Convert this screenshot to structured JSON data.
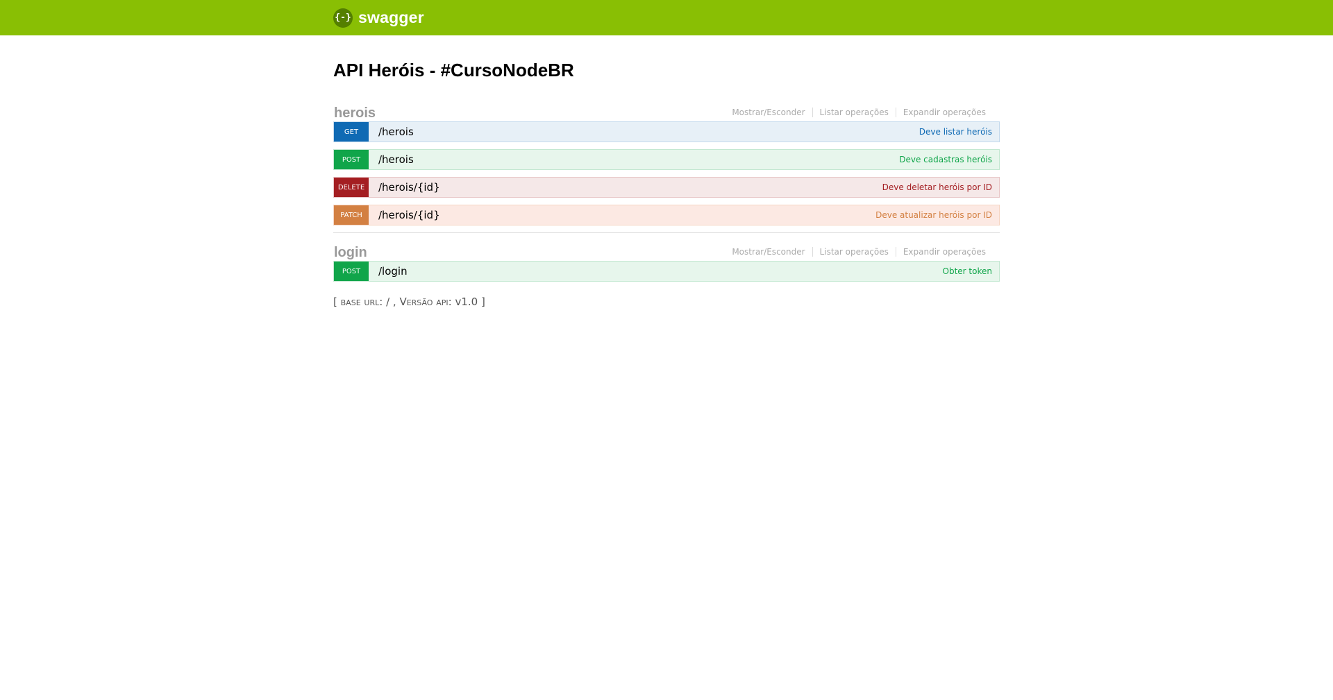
{
  "header": {
    "logo_icon": "{-}",
    "logo_text": "swagger"
  },
  "title": "API Heróis - #CursoNodeBR",
  "resources": [
    {
      "name": "herois",
      "links": [
        "Mostrar/Esconder",
        "Listar operações",
        "Expandir operações"
      ],
      "operations": [
        {
          "method": "GET",
          "path": "/herois",
          "summary": "Deve listar heróis"
        },
        {
          "method": "POST",
          "path": "/herois",
          "summary": "Deve cadastras heróis"
        },
        {
          "method": "DELETE",
          "path": "/herois/{id}",
          "summary": "Deve deletar heróis por ID"
        },
        {
          "method": "PATCH",
          "path": "/herois/{id}",
          "summary": "Deve atualizar heróis por ID"
        }
      ]
    },
    {
      "name": "login",
      "links": [
        "Mostrar/Esconder",
        "Listar operações",
        "Expandir operações"
      ],
      "operations": [
        {
          "method": "POST",
          "path": "/login",
          "summary": "Obter token"
        }
      ]
    }
  ],
  "footer": {
    "open": "[",
    "base_url_label": "base url",
    "base_url_value": ": / , ",
    "version_label": "Versão api",
    "version_value": ": v1.0 ",
    "close": "]"
  },
  "colors": {
    "header": "#89bf04",
    "get": "#0f6ab4",
    "post": "#10a54a",
    "delete": "#a41e22",
    "patch": "#d38042"
  }
}
